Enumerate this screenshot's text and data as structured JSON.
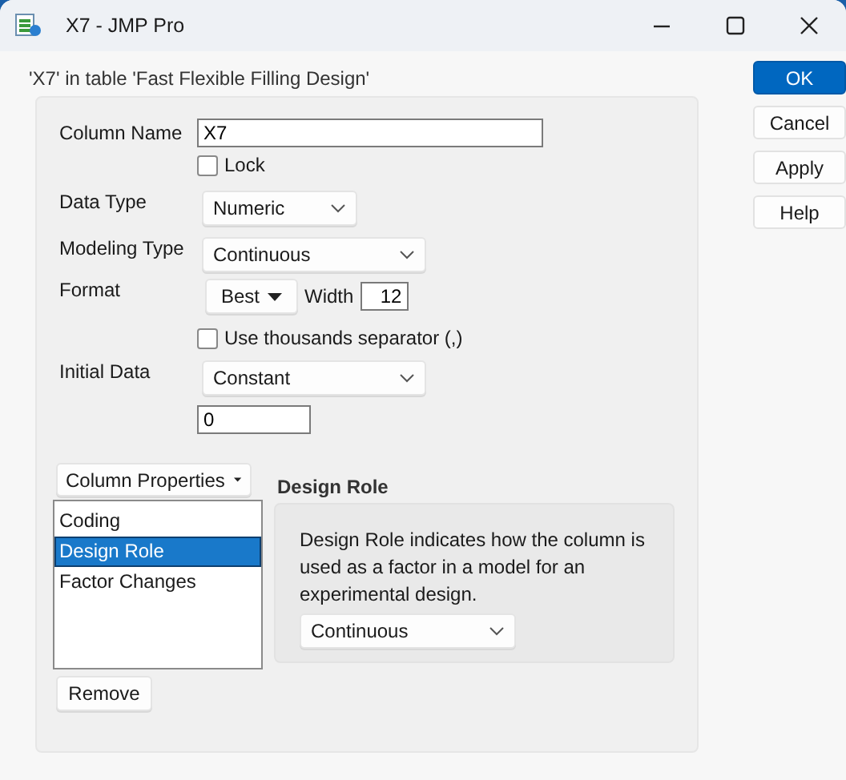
{
  "window": {
    "title": "X7 - JMP Pro"
  },
  "header": "'X7' in table 'Fast Flexible Filling Design'",
  "buttons": [
    {
      "label": "OK",
      "kind": "primary"
    },
    {
      "label": "Cancel",
      "kind": "normal"
    },
    {
      "label": "Apply",
      "kind": "normal"
    },
    {
      "label": "Help",
      "kind": "normal"
    }
  ],
  "column_name": {
    "label": "Column Name",
    "value": "X7"
  },
  "lock": {
    "label": "Lock",
    "checked": false
  },
  "data_type": {
    "label": "Data Type",
    "value": "Numeric"
  },
  "modeling_type": {
    "label": "Modeling Type",
    "value": "Continuous"
  },
  "format": {
    "label": "Format",
    "value": "Best",
    "width_label": "Width",
    "width_value": "12"
  },
  "thousands_separator": {
    "label": "Use thousands separator (,)",
    "checked": false
  },
  "initial_data": {
    "label": "Initial Data",
    "value": "Constant",
    "constant_value": "0"
  },
  "column_properties": {
    "label": "Column Properties",
    "items": [
      {
        "label": "Coding",
        "selected": false
      },
      {
        "label": "Design Role",
        "selected": true
      },
      {
        "label": "Factor Changes",
        "selected": false
      }
    ],
    "remove_label": "Remove"
  },
  "design_role": {
    "title": "Design Role",
    "description": "Design Role indicates how the column is used as a factor in a model for an experimental design.",
    "value": "Continuous"
  }
}
